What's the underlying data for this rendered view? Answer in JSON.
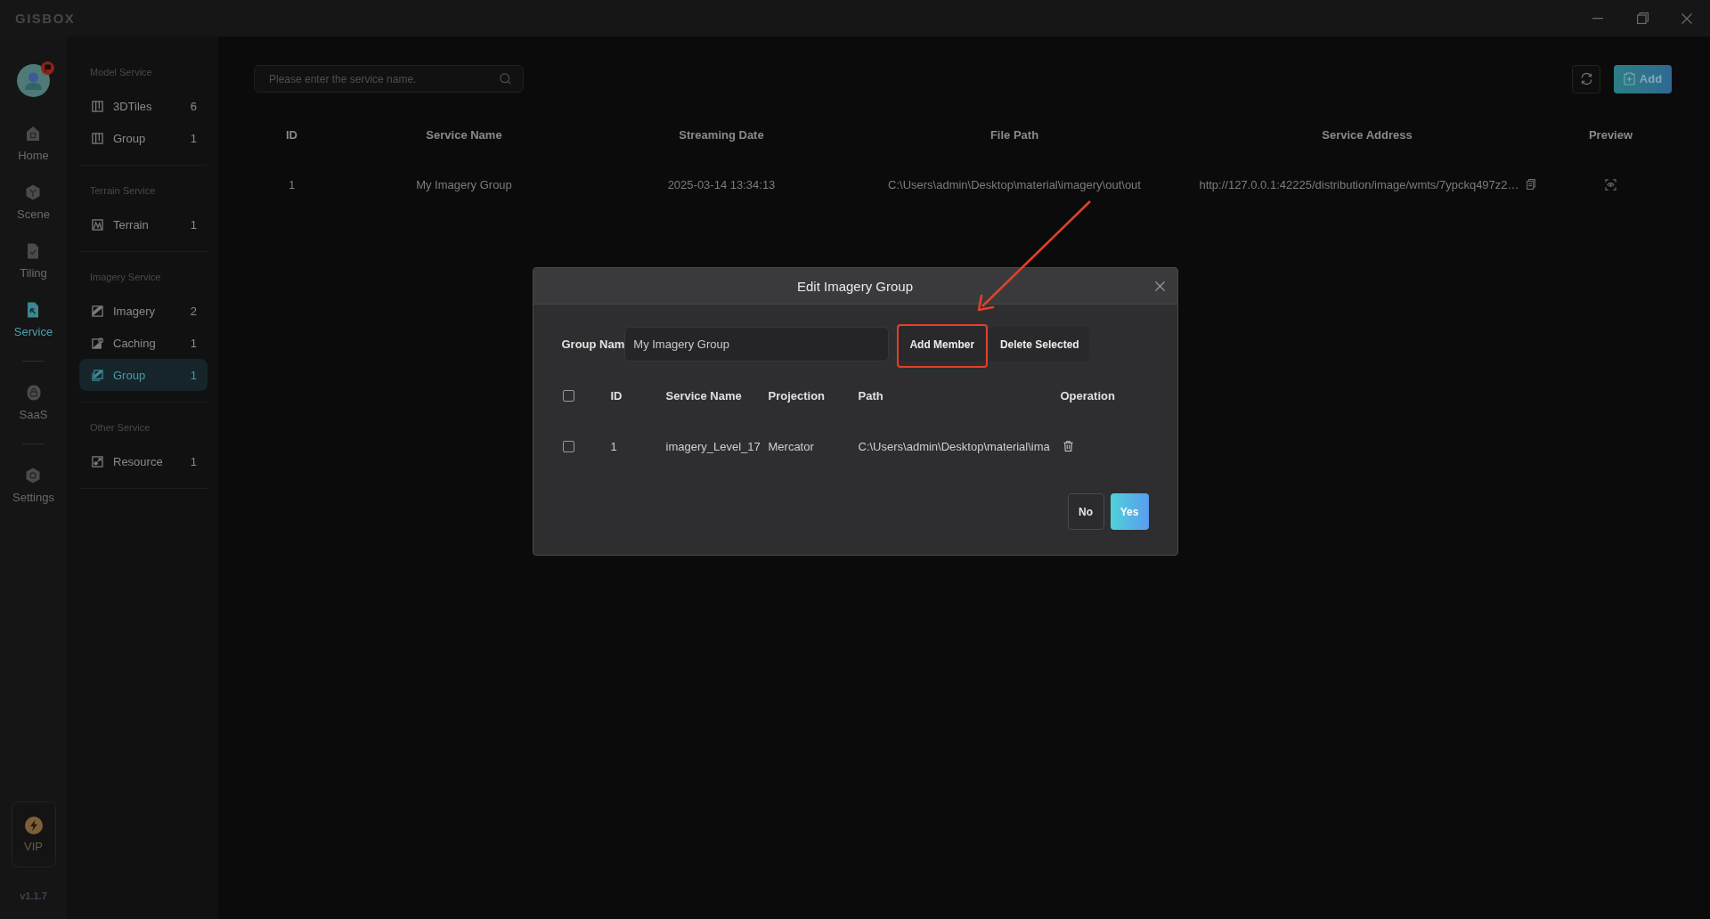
{
  "window": {
    "logo": "GISBOX"
  },
  "rail": {
    "groups": [
      {
        "items": [
          {
            "label": "Home",
            "selected": false
          },
          {
            "label": "Scene",
            "selected": false
          },
          {
            "label": "Tiling",
            "selected": false
          },
          {
            "label": "Service",
            "selected": true
          }
        ]
      },
      {
        "items": [
          {
            "label": "SaaS",
            "selected": false
          }
        ]
      },
      {
        "items": [
          {
            "label": "Settings",
            "selected": false
          }
        ]
      }
    ],
    "vip": "VIP",
    "version": "v1.1.7"
  },
  "sidebar": {
    "sections": [
      {
        "title": "Model Service",
        "items": [
          {
            "label": "3DTiles",
            "count": "6",
            "selected": false
          },
          {
            "label": "Group",
            "count": "1",
            "selected": false
          }
        ]
      },
      {
        "title": "Terrain Service",
        "items": [
          {
            "label": "Terrain",
            "count": "1",
            "selected": false
          }
        ]
      },
      {
        "title": "Imagery Service",
        "items": [
          {
            "label": "Imagery",
            "count": "2",
            "selected": false
          },
          {
            "label": "Caching",
            "count": "1",
            "selected": false
          },
          {
            "label": "Group",
            "count": "1",
            "selected": true
          }
        ]
      },
      {
        "title": "Other Service",
        "items": [
          {
            "label": "Resource",
            "count": "1",
            "selected": false
          }
        ]
      }
    ]
  },
  "search": {
    "placeholder": "Please enter the service name."
  },
  "toolbar": {
    "add_button": "Add"
  },
  "table": {
    "columns": [
      "ID",
      "Service Name",
      "Streaming Date",
      "File Path",
      "Service Address",
      "Preview"
    ],
    "rows": [
      {
        "id": "1",
        "service_name": "My Imagery Group",
        "streaming_date": "2025-03-14 13:34:13",
        "file_path": "C:\\Users\\admin\\Desktop\\material\\imagery\\out\\out",
        "service_address": "http://127.0.0.1:42225/distribution/image/wmts/7ypckq497z2…"
      }
    ]
  },
  "dialog": {
    "title": "Edit Imagery Group",
    "group_name": {
      "label": "Group Nam",
      "value": "My Imagery Group"
    },
    "buttons": [
      {
        "label": "Add Member",
        "highlighted": true
      },
      {
        "label": "Delete Selected",
        "highlighted": false
      }
    ],
    "table": {
      "select_all_checked": false,
      "columns": [
        "ID",
        "Service Name",
        "Projection",
        "Path",
        "Operation"
      ],
      "rows": [
        {
          "checked": false,
          "id": "1",
          "service_name": "imagery_Level_17",
          "projection": "Mercator",
          "path": "C:\\Users\\admin\\Desktop\\material\\ima"
        }
      ]
    },
    "cancel_button": "No",
    "confirm_button": "Yes"
  }
}
